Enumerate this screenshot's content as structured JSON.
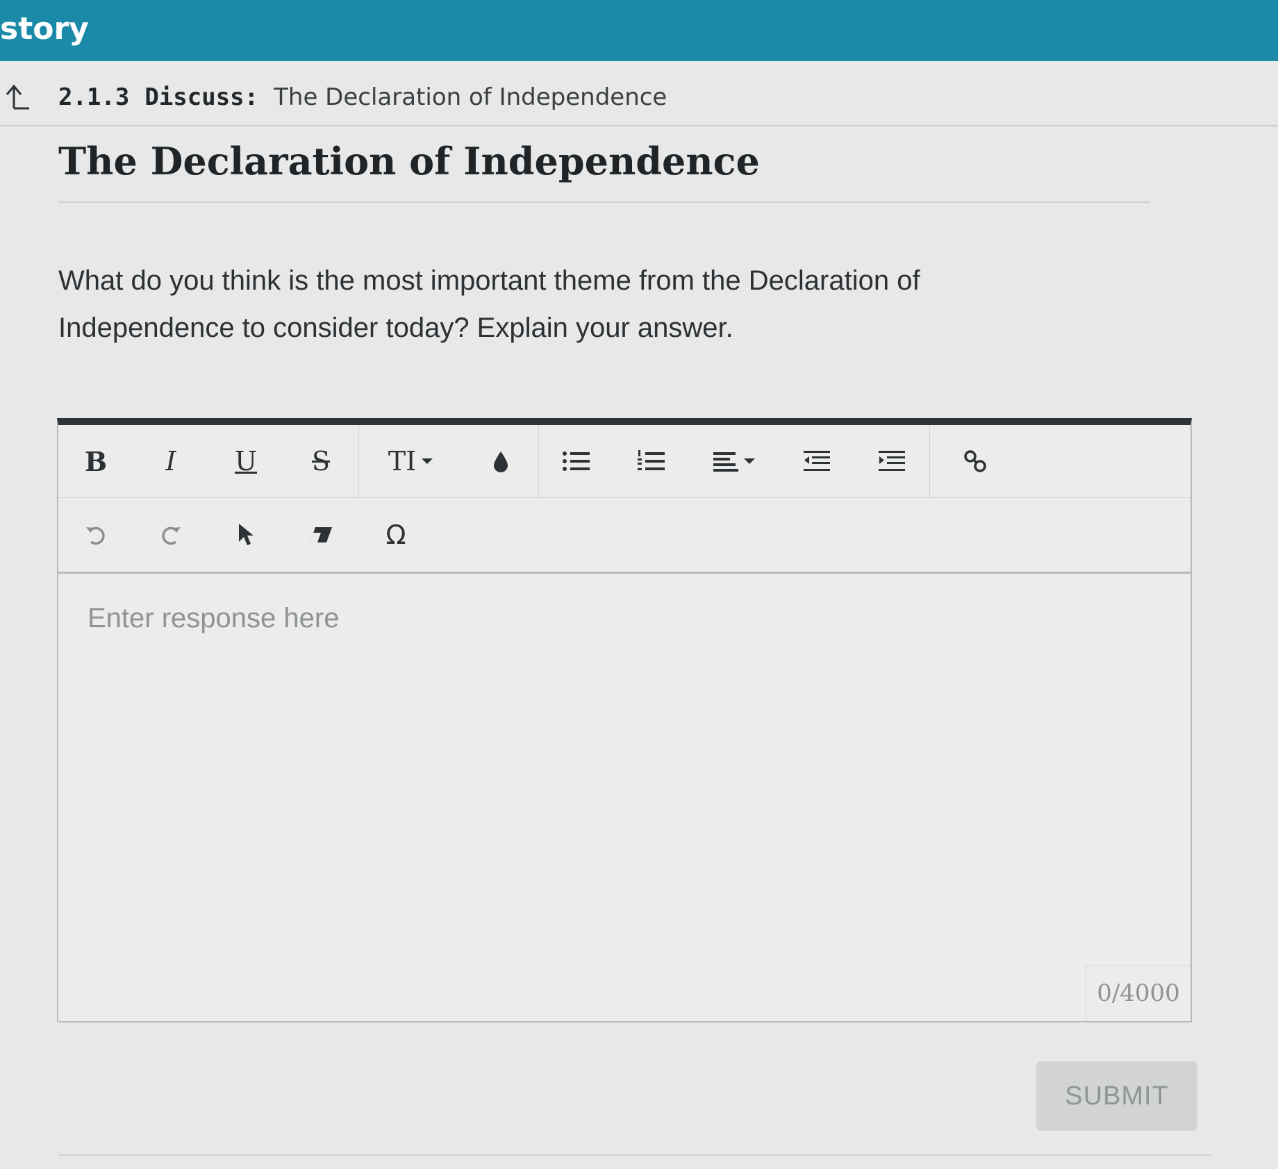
{
  "header": {
    "course_title": "story"
  },
  "breadcrumb": {
    "number": "2.1.3",
    "kind": "Discuss:",
    "title": "The Declaration of Independence"
  },
  "page": {
    "title": "The Declaration of Independence",
    "prompt": "What do you think is the most important theme from the Declaration of Independence to consider today? Explain your answer."
  },
  "toolbar": {
    "bold": "B",
    "italic": "I",
    "underline": "U",
    "strike": "S",
    "font_size": "TI",
    "special_char": "Ω",
    "icons": [
      "bold-icon",
      "italic-icon",
      "underline-icon",
      "strikethrough-icon",
      "font-size-icon",
      "text-color-icon",
      "bullet-list-icon",
      "numbered-list-icon",
      "align-icon",
      "outdent-icon",
      "indent-icon",
      "link-icon",
      "undo-icon",
      "redo-icon",
      "select-pointer-icon",
      "eraser-icon",
      "omega-icon"
    ]
  },
  "editor": {
    "placeholder": "Enter response here",
    "value": "",
    "counter": "0/4000"
  },
  "actions": {
    "submit_label": "SUBMIT"
  },
  "colors": {
    "header_bg": "#1a8aa8",
    "toolbar_border": "#2f3438",
    "submit_bg": "#d2d4d4"
  }
}
